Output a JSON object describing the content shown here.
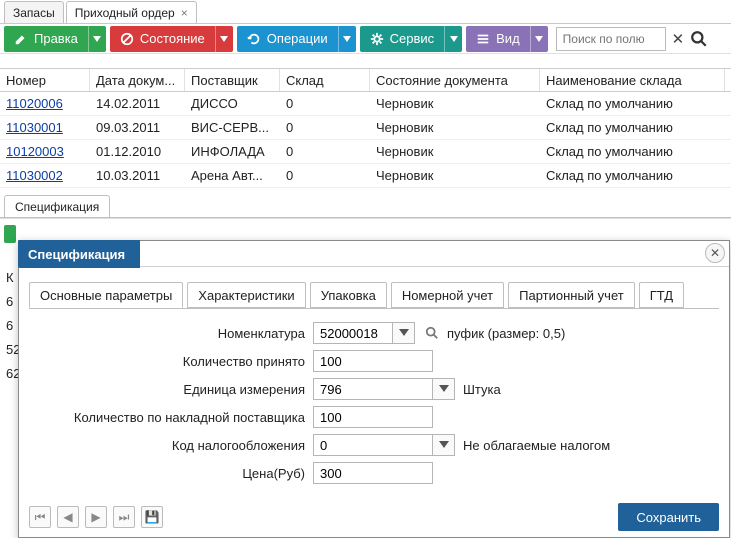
{
  "tabs": {
    "t0": "Запасы",
    "t1": "Приходный ордер"
  },
  "toolbar": {
    "edit": "Правка",
    "state": "Состояние",
    "ops": "Операции",
    "service": "Сервис",
    "view": "Вид",
    "search_placeholder": "Поиск по полю"
  },
  "grid": {
    "headers": {
      "num": "Номер",
      "date": "Дата докум...",
      "supplier": "Поставщик",
      "wh": "Склад",
      "docstate": "Состояние документа",
      "whname": "Наименование склада"
    },
    "rows": [
      {
        "num": "11020006",
        "date": "14.02.2011",
        "supplier": "ДИССО",
        "wh": "0",
        "state": "Черновик",
        "whname": "Склад по умолчанию"
      },
      {
        "num": "11030001",
        "date": "09.03.2011",
        "supplier": "ВИС-СЕРВ...",
        "wh": "0",
        "state": "Черновик",
        "whname": "Склад по умолчанию"
      },
      {
        "num": "10120003",
        "date": "01.12.2010",
        "supplier": "ИНФОЛАДА",
        "wh": "0",
        "state": "Черновик",
        "whname": "Склад по умолчанию"
      },
      {
        "num": "11030002",
        "date": "10.03.2011",
        "supplier": "Арена Авт...",
        "wh": "0",
        "state": "Черновик",
        "whname": "Склад по умолчанию"
      }
    ]
  },
  "spec_tab": "Спецификация",
  "behind": {
    "a": "К",
    "b": "6",
    "c": "6",
    "d": "52",
    "e": "62"
  },
  "dialog": {
    "title": "Спецификация",
    "tabs": {
      "t0": "Основные параметры",
      "t1": "Характеристики",
      "t2": "Упаковка",
      "t3": "Номерной учет",
      "t4": "Партионный учет",
      "t5": "ГТД"
    },
    "labels": {
      "nomen": "Номенклатура",
      "qty": "Количество принято",
      "uom": "Единица измерения",
      "supqty": "Количество по накладной поставщика",
      "tax": "Код налогообложения",
      "price": "Цена(Руб)"
    },
    "values": {
      "nomen": "52000018",
      "nomen_desc": "пуфик (размер: 0,5)",
      "qty": "100",
      "uom": "796",
      "uom_desc": "Штука",
      "supqty": "100",
      "tax": "0",
      "tax_desc": "Не облагаемые налогом",
      "price": "300"
    },
    "save": "Сохранить"
  }
}
